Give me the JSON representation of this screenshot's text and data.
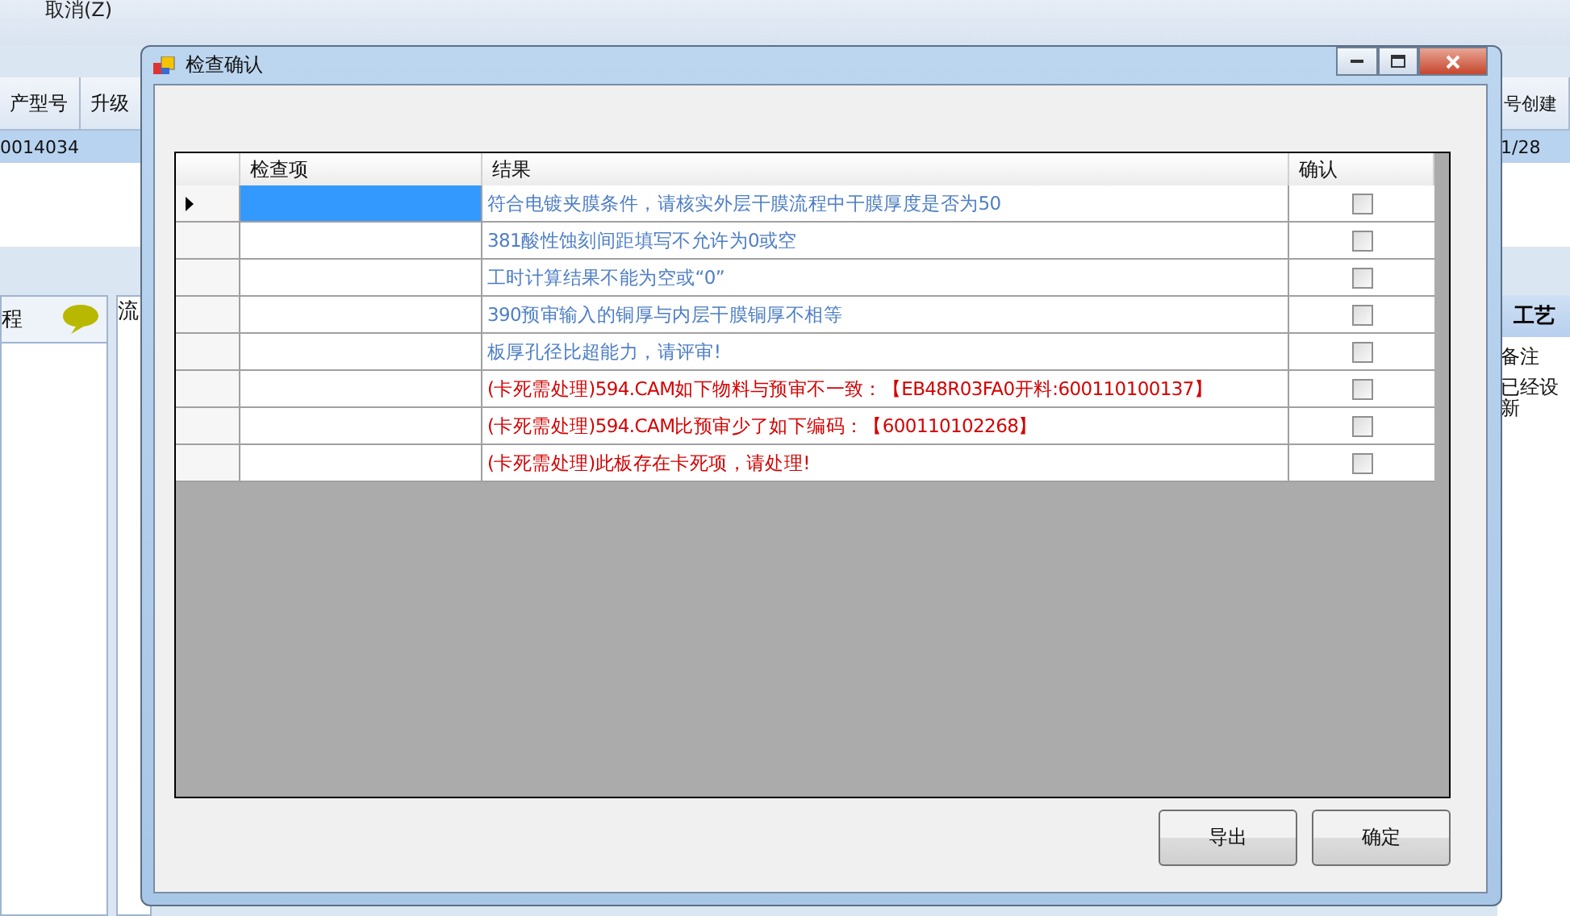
{
  "background_app": {
    "toolbar": {
      "cancel_button": "取消(Z)"
    },
    "grid": {
      "columns": [
        "产型号",
        "升级",
        "号创建"
      ],
      "row": [
        "0014034",
        "1/28"
      ]
    },
    "left_panel": {
      "title": "程"
    },
    "tree_panel": {
      "title": "流"
    },
    "right_panel": {
      "title": "工艺",
      "column": "备注",
      "lines": [
        "已经设",
        "新"
      ]
    }
  },
  "dialog": {
    "title": "检查确认",
    "table": {
      "columns": [
        "检查项",
        "结果",
        "确认"
      ],
      "rows": [
        {
          "item": "",
          "result": "符合电镀夹膜条件，请核实外层干膜流程中干膜厚度是否为50",
          "kind": "notice",
          "checked": false,
          "selected": true
        },
        {
          "item": "",
          "result": "381酸性蚀刻间距填写不允许为0或空",
          "kind": "notice",
          "checked": false,
          "selected": false
        },
        {
          "item": "",
          "result": "工时计算结果不能为空或“0”",
          "kind": "notice",
          "checked": false,
          "selected": false
        },
        {
          "item": "",
          "result": "390预审输入的铜厚与内层干膜铜厚不相等",
          "kind": "notice",
          "checked": false,
          "selected": false
        },
        {
          "item": "",
          "result": "板厚孔径比超能力，请评审!",
          "kind": "notice",
          "checked": false,
          "selected": false
        },
        {
          "item": "",
          "result": "(卡死需处理)594.CAM如下物料与预审不一致：【EB48R03FA0开料:600110100137】",
          "kind": "blocking",
          "checked": false,
          "selected": false
        },
        {
          "item": "",
          "result": "(卡死需处理)594.CAM比预审少了如下编码：【600110102268】",
          "kind": "blocking",
          "checked": false,
          "selected": false
        },
        {
          "item": "",
          "result": "(卡死需处理)此板存在卡死项，请处理!",
          "kind": "blocking",
          "checked": false,
          "selected": false
        }
      ]
    },
    "buttons": [
      "导出",
      "确定"
    ]
  }
}
